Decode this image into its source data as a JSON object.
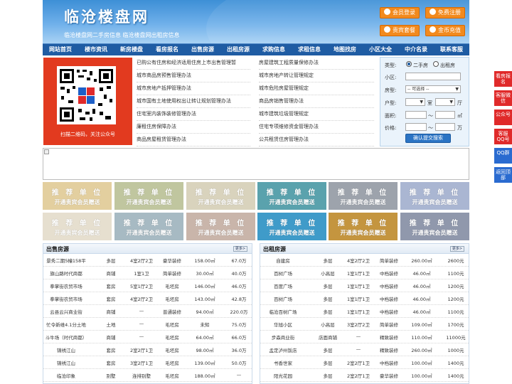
{
  "header": {
    "title": "临沧楼盘网",
    "subtitle": "临沧楼盘网二手房信息   临沧楼盘网出租房信息",
    "buttons": [
      "会员登录",
      "免费注册",
      "贵宾套餐",
      "金币充值"
    ]
  },
  "nav": [
    "网站首页",
    "楼市资讯",
    "新房楼盘",
    "看房报名",
    "出售房源",
    "出租房源",
    "求购信息",
    "求租信息",
    "地图找房",
    "小区大全",
    "中介名录",
    "联系客服"
  ],
  "qr": {
    "caption": "扫描二维码，关注公众号"
  },
  "links": {
    "left": [
      "已购公有住房和经济适用住房上市出售管理暂",
      "城市商品房预售管理办法",
      "城市房地产抵押管理办法",
      "城市国有土地使用权出让转让规划管理办法",
      "住宅室内装饰装修管理办法",
      "廉租住房保障办法",
      "商品房屋租赁管理办法"
    ],
    "right": [
      "房屋建筑工程质量保修办法",
      "城市房地产转让管理规定",
      "城市危险房屋管理规定",
      "商品房销售管理办法",
      "城市建筑垃圾管理规定",
      "住宅专项维修资金管理办法",
      "公共租赁住房管理办法"
    ]
  },
  "search": {
    "type_label": "类型:",
    "type_opts": [
      "二手房",
      "出租房"
    ],
    "area_label": "小区:",
    "house_label": "房型:",
    "house_select": "-- 可选择 --",
    "layout_label": "户型:",
    "room_unit": "室",
    "hall_unit": "厅",
    "size_label": "面积:",
    "size_unit": "㎡",
    "price_label": "价格:",
    "price_unit": "万",
    "dash": "～",
    "submit": "确认提交搜索"
  },
  "tiles": {
    "t1": "推 荐 单 位",
    "t2": "开通贵宾会员赠送"
  },
  "sale": {
    "title": "出售房源",
    "more": "更多>",
    "rows": [
      [
        "景秀二期5幢158平",
        "多层",
        "4室2厅2卫",
        "豪华装修",
        "158.00㎡",
        "67.0万"
      ],
      [
        "旗山路时代商都",
        "商铺",
        "1室1卫",
        "简单装修",
        "30.00㎡",
        "40.0万"
      ],
      [
        "拳掌街农贸市场",
        "套房",
        "5室1厅2卫",
        "毛坯房",
        "146.00㎡",
        "46.0万"
      ],
      [
        "拳掌街农贸市场",
        "套房",
        "4室2厅2卫",
        "毛坯房",
        "143.00㎡",
        "42.8万"
      ],
      [
        "云县云兴商业街",
        "商铺",
        "—",
        "普通装修",
        "94.00㎡",
        "220.0万"
      ],
      [
        "忙令新维4.1分土地",
        "土地",
        "—",
        "毛坯房",
        "未知",
        "75.0万"
      ],
      [
        "斗牛场（时代商都）",
        "商铺",
        "—",
        "毛坯房",
        "64.00㎡",
        "66.0万"
      ],
      [
        "锦绣江山",
        "套房",
        "2室2厅1卫",
        "毛坯房",
        "98.00㎡",
        "36.0万"
      ],
      [
        "锦绣江山",
        "套房",
        "3室2厅1卫",
        "毛坯房",
        "139.00㎡",
        "50.0万"
      ],
      [
        "临沧印象",
        "别墅",
        "连排别墅",
        "毛坯房",
        "188.00㎡",
        "—"
      ]
    ]
  },
  "rent": {
    "title": "出租房源",
    "more": "更多>",
    "rows": [
      [
        "自建房",
        "多层",
        "4室2厅2卫",
        "简单装修",
        "260.00㎡",
        "2600元"
      ],
      [
        "百树广场",
        "小高层",
        "1室1厅1卫",
        "中档装修",
        "46.00㎡",
        "1100元"
      ],
      [
        "百度广场",
        "多层",
        "1室1厅1卫",
        "中档装修",
        "46.00㎡",
        "1200元"
      ],
      [
        "百树广场",
        "多层",
        "1室1厅1卫",
        "中档装修",
        "46.00㎡",
        "1200元"
      ],
      [
        "临沧百树广场",
        "多层",
        "1室1厅1卫",
        "中档装修",
        "46.00㎡",
        "1100元"
      ],
      [
        "华旭小区",
        "小高层",
        "3室2厅2卫",
        "简单装修",
        "109.00㎡",
        "1700元"
      ],
      [
        "步森商业街",
        "店面商铺",
        "—",
        "精致装修",
        "110.00㎡",
        "11000元"
      ],
      [
        "孟定泸州饭店",
        "多层",
        "—",
        "精致装修",
        "260.00㎡",
        "1000元"
      ],
      [
        "书香世家",
        "多层",
        "2室2厅1卫",
        "中档装修",
        "100.00㎡",
        "1400元"
      ],
      [
        "阳光花园",
        "多层",
        "2室2厅1卫",
        "豪华装修",
        "100.00㎡",
        "1400元"
      ]
    ]
  },
  "sidebar": [
    "看房报名",
    "客服微信",
    "公众号",
    "客服QQ号",
    "QQ群",
    "返回顶部"
  ],
  "colors": {
    "nav": "#1f5ca3",
    "accent": "#f28a1e",
    "qr_bg": "#e23a1f",
    "side": "#e02a2a"
  }
}
